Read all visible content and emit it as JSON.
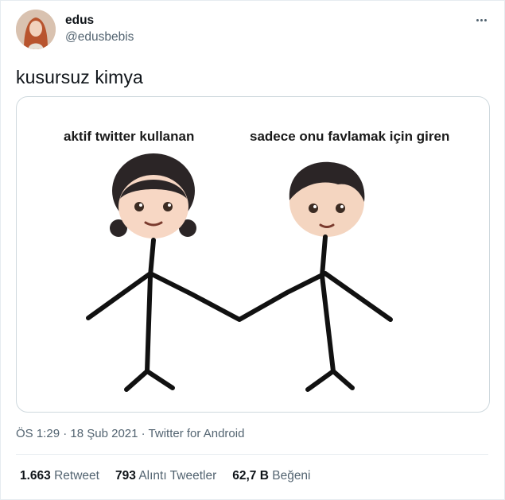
{
  "author": {
    "display_name": "edus",
    "handle": "@edusbebis",
    "avatar_icon": "user-avatar"
  },
  "tweet": {
    "text": "kusursuz kimya"
  },
  "media": {
    "left_label": "aktif twitter kullanan",
    "right_label": "sadece onu favlamak için giren"
  },
  "meta": {
    "time": "ÖS 1:29",
    "date": "18 Şub 2021",
    "source": "Twitter for Android",
    "separator": "·"
  },
  "stats": {
    "retweets_count": "1.663",
    "retweets_label": "Retweet",
    "quotes_count": "793",
    "quotes_label": "Alıntı Tweetler",
    "likes_count": "62,7 B",
    "likes_label": "Beğeni"
  },
  "colors": {
    "text": "#0f1419",
    "secondary": "#536471",
    "border": "#cfd9de"
  }
}
